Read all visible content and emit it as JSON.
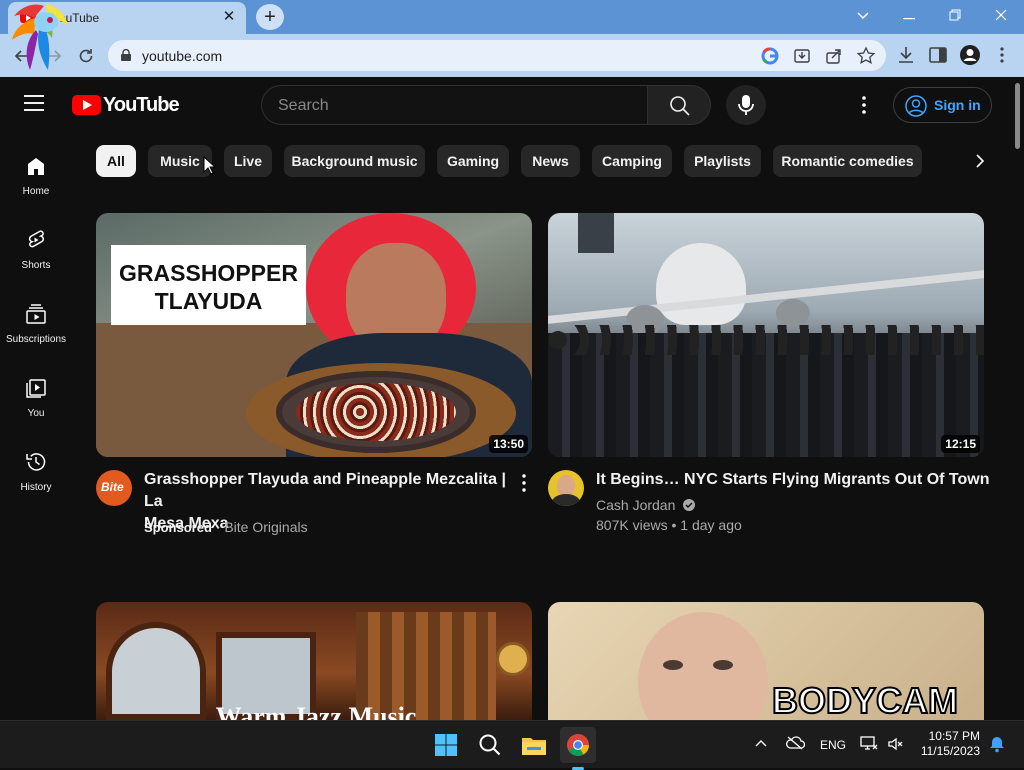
{
  "browser": {
    "tab_title": "YouTube",
    "url": "youtube.com"
  },
  "masthead": {
    "logo_text": "YouTube",
    "search_placeholder": "Search",
    "signin_label": "Sign in"
  },
  "guide": [
    {
      "label": "Home",
      "icon": "home-icon"
    },
    {
      "label": "Shorts",
      "icon": "shorts-icon"
    },
    {
      "label": "Subscriptions",
      "icon": "subscriptions-icon"
    },
    {
      "label": "You",
      "icon": "you-icon"
    },
    {
      "label": "History",
      "icon": "history-icon"
    }
  ],
  "chips": [
    "All",
    "Music",
    "Live",
    "Background music",
    "Gaming",
    "News",
    "Camping",
    "Playlists",
    "Romantic comedies"
  ],
  "videos": [
    {
      "title_line1": "Grasshopper Tlayuda and Pineapple Mezcalita | La",
      "title_line2": "Mesa Mexa",
      "sponsored": "Sponsored",
      "channel": "· Bite Originals",
      "duration": "13:50",
      "thumb_text_line1": "GRASSHOPPER",
      "thumb_text_line2": "TLAYUDA",
      "avatar_text": "Bite"
    },
    {
      "title_line1": "It Begins… NYC Starts Flying Migrants Out Of Town",
      "channel": "Cash Jordan",
      "stats": "807K views • 1 day ago",
      "duration": "12:15"
    },
    {
      "thumb_text": "Warm Jazz Music"
    },
    {
      "thumb_text": "BODYCAM"
    }
  ],
  "taskbar": {
    "language": "ENG",
    "time": "10:57 PM",
    "date": "11/15/2023"
  }
}
